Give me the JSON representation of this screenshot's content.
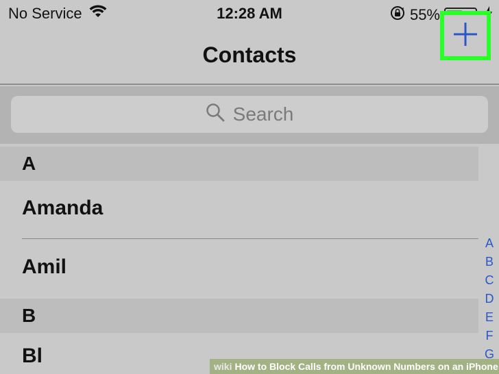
{
  "status_bar": {
    "carrier": "No Service",
    "time": "12:28 AM",
    "battery_percent": "55%",
    "battery_level": 0.55
  },
  "nav": {
    "title": "Contacts"
  },
  "search": {
    "placeholder": "Search"
  },
  "sections": [
    {
      "letter": "A",
      "contacts": [
        "Amanda",
        "Amil"
      ]
    },
    {
      "letter": "B",
      "contacts": [
        "Bl"
      ]
    }
  ],
  "index_letters": [
    "A",
    "B",
    "C",
    "D",
    "E",
    "F",
    "G"
  ],
  "watermark": {
    "brand": "wiki",
    "text": "How to Block Calls from Unknown Numbers on an iPhone"
  },
  "colors": {
    "accent": "#2a56c6",
    "highlight": "#2aff2a",
    "battery": "#3fbf3f"
  },
  "icons": [
    "wifi-icon",
    "rotation-lock-icon",
    "battery-icon",
    "charging-bolt-icon",
    "plus-icon",
    "search-icon"
  ]
}
